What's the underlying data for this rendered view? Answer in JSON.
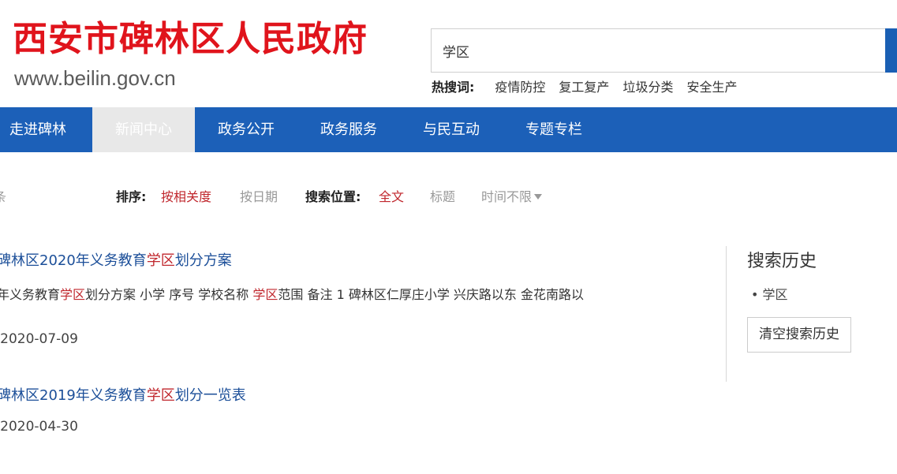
{
  "header": {
    "site_title": "西安市碑林区人民政府",
    "site_url": "www.beilin.gov.cn"
  },
  "search": {
    "value": "学区",
    "hot_label": "热搜词:",
    "hot_terms": [
      "疫情防控",
      "复工复产",
      "垃圾分类",
      "安全生产"
    ]
  },
  "nav": {
    "items": [
      "走进碑林",
      "新闻中心",
      "政务公开",
      "政务服务",
      "与民互动",
      "专题专栏"
    ],
    "active_index": 1
  },
  "filters": {
    "count_fragment": "条",
    "sort_label": "排序:",
    "sort_options": [
      "按相关度",
      "按日期"
    ],
    "position_label": "搜索位置:",
    "position_options": [
      "全文",
      "标题"
    ],
    "time_option": "时间不限"
  },
  "results": [
    {
      "title_pre": "碑林区2020年义务教育",
      "title_hl": "学区",
      "title_post": "划分方案",
      "snippet_pre": "年义务教育",
      "snippet_hl1": "学区",
      "snippet_mid": "划分方案 小学 序号 学校名称 ",
      "snippet_hl2": "学区",
      "snippet_post": "范围 备注 1 碑林区仁厚庄小学 兴庆路以东 金花南路以",
      "date": "-2020-07-09"
    },
    {
      "title_pre": "碑林区2019年义务教育",
      "title_hl": "学区",
      "title_post": "划分一览表",
      "date": "-2020-04-30"
    }
  ],
  "sidebar": {
    "title": "搜索历史",
    "history": [
      "学区"
    ],
    "clear_label": "清空搜索历史"
  },
  "colors": {
    "brand_red": "#e0141c",
    "nav_blue": "#1c60b8",
    "link_blue": "#1c4f99",
    "highlight_red": "#c0272d"
  }
}
